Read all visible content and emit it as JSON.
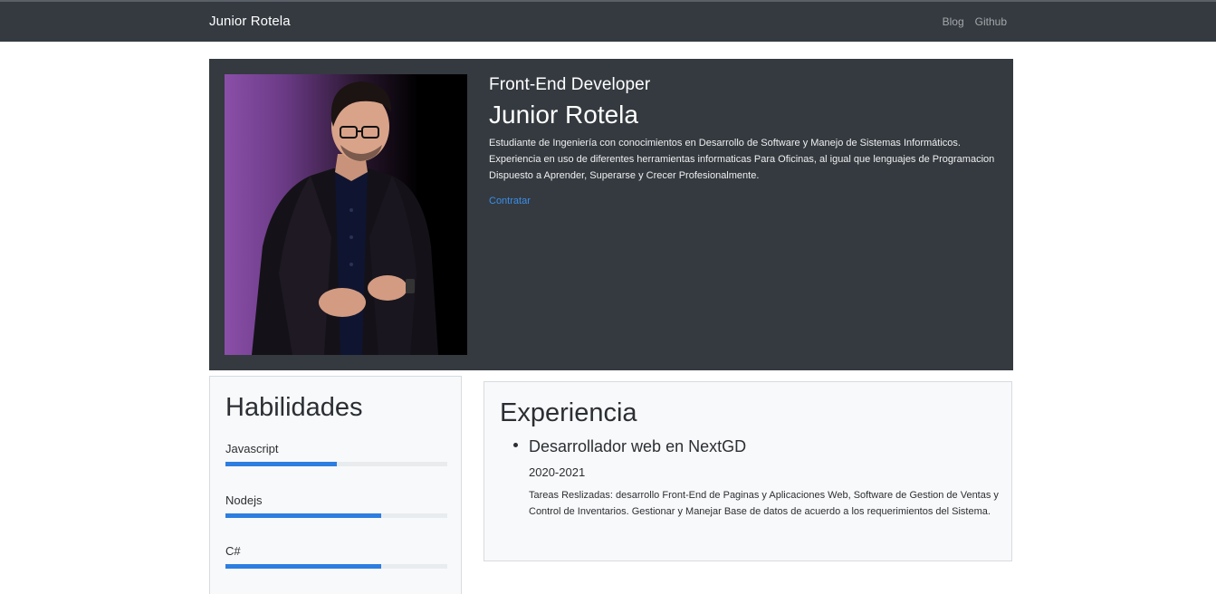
{
  "navbar": {
    "brand": "Junior Rotela",
    "links": [
      {
        "label": "Blog"
      },
      {
        "label": "Github"
      }
    ]
  },
  "hero": {
    "role": "Front-End Developer",
    "name": "Junior Rotela",
    "bio": "Estudiante de Ingeniería con conocimientos en Desarrollo de Software y Manejo de Sistemas Informáticos. Experiencia en uso de diferentes herramientas informaticas Para Oficinas, al igual que lenguajes de Programacion Dispuesto a Aprender, Superarse y Crecer Profesionalmente.",
    "cta": "Contratar"
  },
  "skills": {
    "title": "Habilidades",
    "items": [
      {
        "label": "Javascript",
        "level": 0.5
      },
      {
        "label": "Nodejs",
        "level": 0.7
      },
      {
        "label": "C#",
        "level": 0.7
      }
    ]
  },
  "experience": {
    "title": "Experiencia",
    "jobs": [
      {
        "title": "Desarrollador web en NextGD",
        "dates": "2020-2021",
        "description": "Tareas Reslizadas: desarrollo Front-End de Paginas y Aplicaciones Web, Software de Gestion de Ventas y Control de Inventarios. Gestionar y Manejar Base de datos de acuerdo a los requerimientos del Sistema."
      }
    ]
  },
  "colors": {
    "navbar_bg": "#343a40",
    "accent": "#2d7ee0",
    "link": "#3b8ee8",
    "card_bg": "#f8f9fa"
  }
}
